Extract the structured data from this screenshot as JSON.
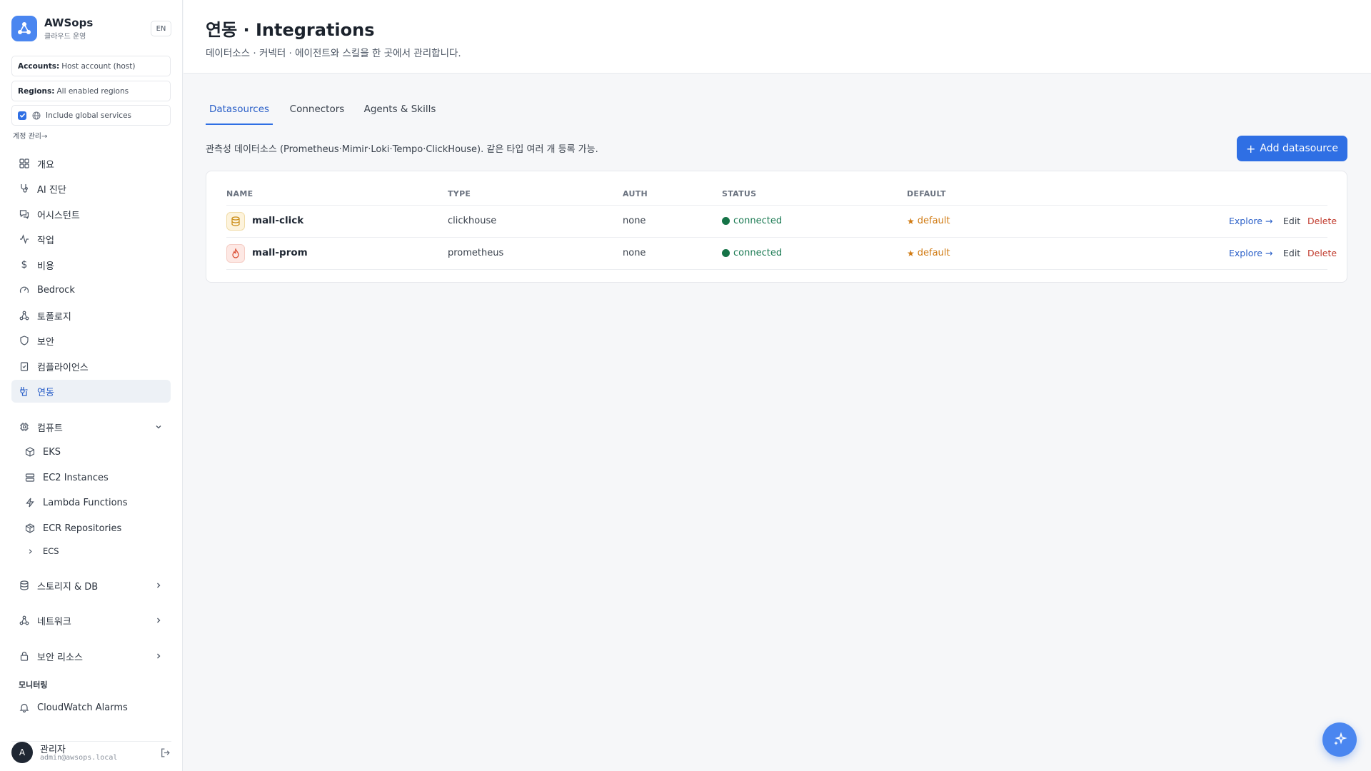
{
  "brand": {
    "name": "AWSops",
    "subtitle": "클라우드 운영",
    "lang": "EN"
  },
  "filters": {
    "accounts_label": "Accounts:",
    "accounts_value": "Host account (host)",
    "regions_label": "Regions:",
    "regions_value": "All enabled regions",
    "global_label": "Include global services",
    "global_checked": true
  },
  "account_link": "계정 관리→",
  "nav": {
    "overview": "개요",
    "ai_diagnosis": "AI 진단",
    "assistant": "어시스턴트",
    "tasks": "작업",
    "cost": "비용",
    "bedrock": "Bedrock",
    "topology": "토폴로지",
    "security": "보안",
    "compliance": "컴플라이언스",
    "integrations": "연동",
    "compute": "컴퓨트",
    "compute_items": [
      "EKS",
      "EC2 Instances",
      "Lambda Functions",
      "ECR Repositories",
      "ECS"
    ],
    "storage_db": "스토리지 & DB",
    "network": "네트워크",
    "security_resources": "보안 리소스",
    "monitoring_label": "모니터링",
    "cloudwatch": "CloudWatch Alarms"
  },
  "user": {
    "initial": "A",
    "name": "관리자",
    "email": "admin@awsops.local"
  },
  "page": {
    "title": "연동 · Integrations",
    "subtitle": "데이터소스 · 커넥터 · 에이전트와 스킬을 한 곳에서 관리합니다."
  },
  "tabs": [
    "Datasources",
    "Connectors",
    "Agents & Skills"
  ],
  "active_tab": "Datasources",
  "datasources": {
    "description": "관측성 데이터소스 (Prometheus·Mimir·Loki·Tempo·ClickHouse). 같은 타입 여러 개 등록 가능.",
    "add_button": "Add datasource",
    "columns": [
      "NAME",
      "TYPE",
      "AUTH",
      "STATUS",
      "DEFAULT"
    ],
    "rows": [
      {
        "name": "mall-click",
        "type": "clickhouse",
        "auth": "none",
        "status": "connected",
        "default": "default",
        "icon": "database-icon"
      },
      {
        "name": "mall-prom",
        "type": "prometheus",
        "auth": "none",
        "status": "connected",
        "default": "default",
        "icon": "flame-icon"
      }
    ],
    "actions": {
      "explore": "Explore →",
      "edit": "Edit",
      "delete": "Delete"
    }
  },
  "colors": {
    "accent": "#2f6fe4",
    "connected": "#157347",
    "default": "#d07a12",
    "delete": "#c0392b"
  }
}
